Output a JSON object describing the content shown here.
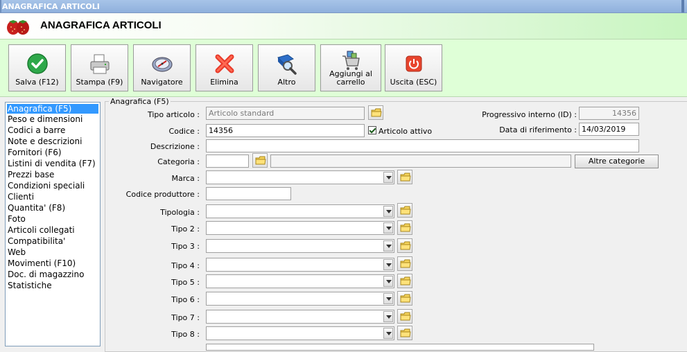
{
  "window": {
    "title": "ANAGRAFICA ARTICOLI"
  },
  "header": {
    "title": "ANAGRAFICA ARTICOLI"
  },
  "toolbar": {
    "buttons": [
      {
        "label": "Salva (F12)",
        "icon": "check-icon"
      },
      {
        "label": "Stampa (F9)",
        "icon": "printer-icon"
      },
      {
        "label": "Navigatore",
        "icon": "compass-icon"
      },
      {
        "label": "Elimina",
        "icon": "delete-x-icon"
      },
      {
        "label": "Altro",
        "icon": "book-magnifier-icon"
      },
      {
        "label_line1": "Aggiungi al",
        "label_line2": "carrello",
        "icon": "cart-icon"
      },
      {
        "label": "Uscita (ESC)",
        "icon": "power-icon"
      }
    ]
  },
  "sidebar": {
    "items": [
      {
        "label": "Anagrafica (F5)",
        "selected": true
      },
      {
        "label": "Peso e dimensioni"
      },
      {
        "label": "Codici a barre"
      },
      {
        "label": "Note e descrizioni"
      },
      {
        "label": "Fornitori (F6)"
      },
      {
        "label": "Listini di vendita (F7)"
      },
      {
        "label": "Prezzi base"
      },
      {
        "label": "Condizioni speciali"
      },
      {
        "label": "Clienti"
      },
      {
        "label": "Quantita' (F8)"
      },
      {
        "label": "Foto"
      },
      {
        "label": "Articoli collegati"
      },
      {
        "label": "Compatibilita'"
      },
      {
        "label": "Web"
      },
      {
        "label": "Movimenti (F10)"
      },
      {
        "label": "Doc. di magazzino"
      },
      {
        "label": "Statistiche"
      }
    ]
  },
  "form": {
    "group_title": "Anagrafica (F5)",
    "tipo_articolo": {
      "label": "Tipo articolo :",
      "value": "Articolo standard"
    },
    "codice": {
      "label": "Codice :",
      "value": "14356"
    },
    "articolo_attivo": {
      "label": "Articolo attivo",
      "checked": true
    },
    "progressivo": {
      "label": "Progressivo interno (ID) :",
      "value": "14356"
    },
    "data_riferimento": {
      "label": "Data di riferimento :",
      "value": "14/03/2019"
    },
    "descrizione": {
      "label": "Descrizione :",
      "value": ""
    },
    "categoria": {
      "label": "Categoria :",
      "value": ""
    },
    "altre_categorie": {
      "label": "Altre categorie"
    },
    "marca": {
      "label": "Marca :"
    },
    "codice_produttore": {
      "label": "Codice produttore :",
      "value": ""
    },
    "tipologia": {
      "label": "Tipologia :"
    },
    "tipo2": {
      "label": "Tipo 2 :"
    },
    "tipo3": {
      "label": "Tipo 3 :"
    },
    "tipo4": {
      "label": "Tipo 4 :"
    },
    "tipo5": {
      "label": "Tipo 5 :"
    },
    "tipo6": {
      "label": "Tipo 6 :"
    },
    "tipo7": {
      "label": "Tipo 7 :"
    },
    "tipo8": {
      "label": "Tipo 8 :"
    }
  }
}
